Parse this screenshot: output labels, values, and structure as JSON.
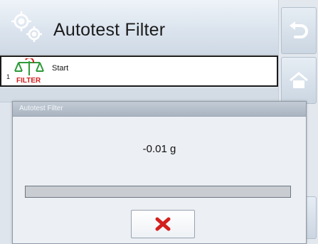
{
  "header": {
    "title": "Autotest Filter",
    "icon": "gears-icon"
  },
  "sidebar": {
    "buttons": [
      {
        "name": "back",
        "icon": "undo-arrow-icon"
      },
      {
        "name": "home",
        "icon": "home-icon"
      }
    ]
  },
  "list": {
    "items": [
      {
        "index": "1",
        "icon": "filter-autotest-icon",
        "icon_text": "FILTER",
        "label": "Start"
      }
    ]
  },
  "dialog": {
    "title": "Autotest Filter",
    "reading": "-0.01 g",
    "progress": 0.0,
    "cancel_icon": "close-x-icon"
  },
  "colors": {
    "cancel_red": "#d41f1f",
    "filter_red": "#d01e1e",
    "filter_green": "#2f9a3a"
  }
}
